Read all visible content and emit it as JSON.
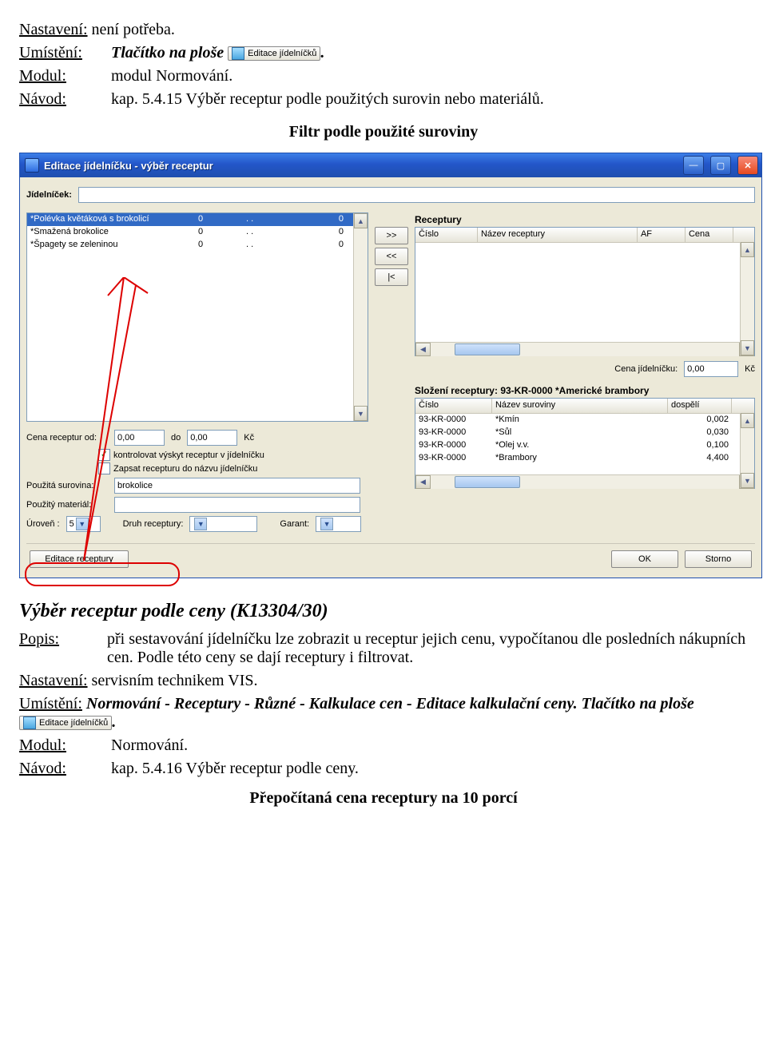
{
  "doc": {
    "nastaveni_label": "Nastavení:",
    "nastaveni_value": "není potřeba.",
    "umisteni_label": "Umístění:",
    "umisteni_value": "Tlačítko na ploše ",
    "mini_btn_label": "Editace jídelníčků",
    "modul_label": "Modul:",
    "modul_value": "modul Normování.",
    "navod_label": "Návod:",
    "navod_value": "kap. 5.4.15 Výběr receptur podle použitých surovin nebo materiálů.",
    "caption": "Filtr podle použité suroviny"
  },
  "win": {
    "title": "Editace jídelníčku - výběr receptur",
    "jidelnicek_label": "Jídelníček:",
    "recipes_title": "Receptury",
    "left": {
      "rows": [
        {
          "name": "*Polévka květáková s brokolicí",
          "c1": "0",
          "c2": ". .",
          "c3": "0"
        },
        {
          "name": "*Smažená brokolice",
          "c1": "0",
          "c2": ". .",
          "c3": "0"
        },
        {
          "name": "*Špagety se zeleninou",
          "c1": "0",
          "c2": ". .",
          "c3": "0"
        }
      ]
    },
    "btns": {
      "add": ">>",
      "remove": "<<",
      "first": "|<"
    },
    "right_head": {
      "cislo": "Číslo",
      "nazev": "Název receptury",
      "af": "AF",
      "cena": "Cena"
    },
    "cena_jidelnicku_label": "Cena jídelníčku:",
    "cena_jidelnicku_value": "0,00",
    "kc": "Kč",
    "options": {
      "cena_od_label": "Cena receptur od:",
      "cena_od_value": "0,00",
      "do_label": "do",
      "cena_do_value": "0,00",
      "chk1_label": "kontrolovat výskyt receptur v jídelníčku",
      "chk2_label": "Zapsat recepturu do názvu jídelníčku",
      "pouzita_surovina_label": "Použitá surovina:",
      "pouzita_surovina_value": "brokolice",
      "pouzity_material_label": "Použitý materiál:",
      "pouzity_material_value": "",
      "uroven_label": "Úroveň :",
      "uroven_value": "5",
      "druh_label": "Druh receptury:",
      "druh_value": "",
      "garant_label": "Garant:",
      "garant_value": ""
    },
    "comp": {
      "title": "Složení receptury: 93-KR-0000  *Americké brambory",
      "head": {
        "cislo": "Číslo",
        "nazev": "Název suroviny",
        "dospeli": "dospělí"
      },
      "rows": [
        {
          "cislo": "93-KR-0000",
          "nazev": "*Kmín",
          "val": "0,002"
        },
        {
          "cislo": "93-KR-0000",
          "nazev": "*Sůl",
          "val": "0,030"
        },
        {
          "cislo": "93-KR-0000",
          "nazev": "*Olej v.v.",
          "val": "0,100"
        },
        {
          "cislo": "93-KR-0000",
          "nazev": "*Brambory",
          "val": "4,400"
        }
      ]
    },
    "bottom": {
      "edit": "Editace receptury",
      "ok": "OK",
      "storno": "Storno"
    }
  },
  "sec2": {
    "heading": "Výběr receptur podle ceny (K13304/30)",
    "popis_label": "Popis:",
    "popis_value": "při sestavování jídelníčku lze zobrazit u receptur jejich cenu, vypočítanou dle posledních nákupních cen. Podle této ceny se dají receptury i filtrovat.",
    "nastaveni_label": "Nastavení:",
    "nastaveni_value": "servisním technikem VIS.",
    "umisteni_label": "Umístění:",
    "umisteni_value_pre": "Normování - Receptury - Různé - Kalkulace cen - Editace kalkulační ceny. Tlačítko na ploše ",
    "mini_btn_label": "Editace jídelníčků",
    "modul_label": "Modul:",
    "modul_value": "Normování.",
    "navod_label": "Návod:",
    "navod_value": "kap. 5.4.16 Výběr receptur podle ceny.",
    "caption": "Přepočítaná cena receptury na 10 porcí"
  }
}
